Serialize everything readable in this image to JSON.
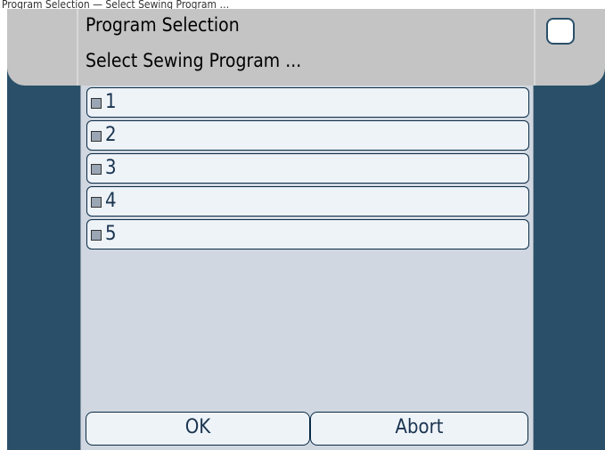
{
  "caption": "Program Selection — Select Sewing Program …",
  "header": {
    "title": "Program Selection",
    "subtitle": "Select Sewing Program ..."
  },
  "program_list": [
    {
      "label": "1"
    },
    {
      "label": "2"
    },
    {
      "label": "3"
    },
    {
      "label": "4"
    },
    {
      "label": "5"
    }
  ],
  "buttons": {
    "ok": "OK",
    "abort": "Abort"
  },
  "colors": {
    "screen_background": "#2a5069",
    "header_background": "#c4c4c4",
    "content_background": "#d0d7e0",
    "item_background": "#eef3f8"
  }
}
